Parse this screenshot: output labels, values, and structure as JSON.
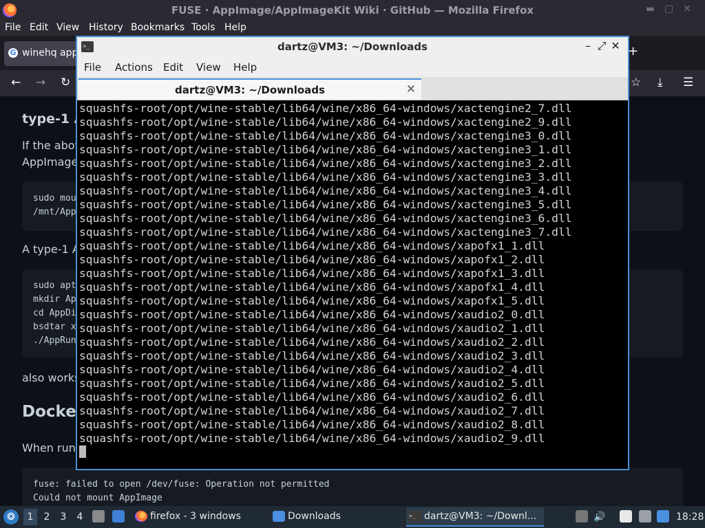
{
  "firefox": {
    "window_title": "FUSE · AppImage/AppImageKit Wiki · GitHub — Mozilla Firefox",
    "menu": [
      "File",
      "Edit",
      "View",
      "History",
      "Bookmarks",
      "Tools",
      "Help"
    ],
    "tab_label": "winehq app",
    "new_tab": "+",
    "content": {
      "heading_type1": "type-1 A",
      "para_if_above_1": "If the above",
      "para_if_above_2": "AppImage",
      "code1": [
        "sudo mou",
        "/mnt/App"
      ],
      "para_type1": "A type-1 Ap",
      "code2": [
        "sudo apt",
        "mkdir Ap",
        "cd AppDi",
        "bsdtar x",
        "./AppRun"
      ],
      "para_also": "also works.",
      "heading_docker": "Docker",
      "para_when": "When runn",
      "code3": [
        "fuse: failed to open /dev/fuse: Operation not permitted",
        "Could not mount AppImage"
      ]
    }
  },
  "terminal": {
    "title": "dartz@VM3: ~/Downloads",
    "menu": [
      "File",
      "Actions",
      "Edit",
      "View",
      "Help"
    ],
    "tab_label": "dartz@VM3: ~/Downloads",
    "lines": [
      "squashfs-root/opt/wine-stable/lib64/wine/x86_64-windows/xactengine2_7.dll",
      "squashfs-root/opt/wine-stable/lib64/wine/x86_64-windows/xactengine2_9.dll",
      "squashfs-root/opt/wine-stable/lib64/wine/x86_64-windows/xactengine3_0.dll",
      "squashfs-root/opt/wine-stable/lib64/wine/x86_64-windows/xactengine3_1.dll",
      "squashfs-root/opt/wine-stable/lib64/wine/x86_64-windows/xactengine3_2.dll",
      "squashfs-root/opt/wine-stable/lib64/wine/x86_64-windows/xactengine3_3.dll",
      "squashfs-root/opt/wine-stable/lib64/wine/x86_64-windows/xactengine3_4.dll",
      "squashfs-root/opt/wine-stable/lib64/wine/x86_64-windows/xactengine3_5.dll",
      "squashfs-root/opt/wine-stable/lib64/wine/x86_64-windows/xactengine3_6.dll",
      "squashfs-root/opt/wine-stable/lib64/wine/x86_64-windows/xactengine3_7.dll",
      "squashfs-root/opt/wine-stable/lib64/wine/x86_64-windows/xapofx1_1.dll",
      "squashfs-root/opt/wine-stable/lib64/wine/x86_64-windows/xapofx1_2.dll",
      "squashfs-root/opt/wine-stable/lib64/wine/x86_64-windows/xapofx1_3.dll",
      "squashfs-root/opt/wine-stable/lib64/wine/x86_64-windows/xapofx1_4.dll",
      "squashfs-root/opt/wine-stable/lib64/wine/x86_64-windows/xapofx1_5.dll",
      "squashfs-root/opt/wine-stable/lib64/wine/x86_64-windows/xaudio2_0.dll",
      "squashfs-root/opt/wine-stable/lib64/wine/x86_64-windows/xaudio2_1.dll",
      "squashfs-root/opt/wine-stable/lib64/wine/x86_64-windows/xaudio2_2.dll",
      "squashfs-root/opt/wine-stable/lib64/wine/x86_64-windows/xaudio2_3.dll",
      "squashfs-root/opt/wine-stable/lib64/wine/x86_64-windows/xaudio2_4.dll",
      "squashfs-root/opt/wine-stable/lib64/wine/x86_64-windows/xaudio2_5.dll",
      "squashfs-root/opt/wine-stable/lib64/wine/x86_64-windows/xaudio2_6.dll",
      "squashfs-root/opt/wine-stable/lib64/wine/x86_64-windows/xaudio2_7.dll",
      "squashfs-root/opt/wine-stable/lib64/wine/x86_64-windows/xaudio2_8.dll",
      "squashfs-root/opt/wine-stable/lib64/wine/x86_64-windows/xaudio2_9.dll"
    ]
  },
  "taskbar": {
    "workspaces": [
      "1",
      "2",
      "3",
      "4"
    ],
    "tasks": [
      {
        "label": "firefox - 3 windows",
        "icon": "firefox-icon"
      },
      {
        "label": "Downloads",
        "icon": "folder-icon"
      },
      {
        "label": "dartz@VM3: ~/Downl...",
        "icon": "terminal-icon"
      }
    ],
    "clock": "18:28"
  },
  "colors": {
    "accent": "#4a90d9",
    "terminal_bg": "#000000",
    "terminal_fg": "#d3d3d3",
    "github_bg": "#0d1117",
    "taskbar_bg": "#1f2a35"
  }
}
